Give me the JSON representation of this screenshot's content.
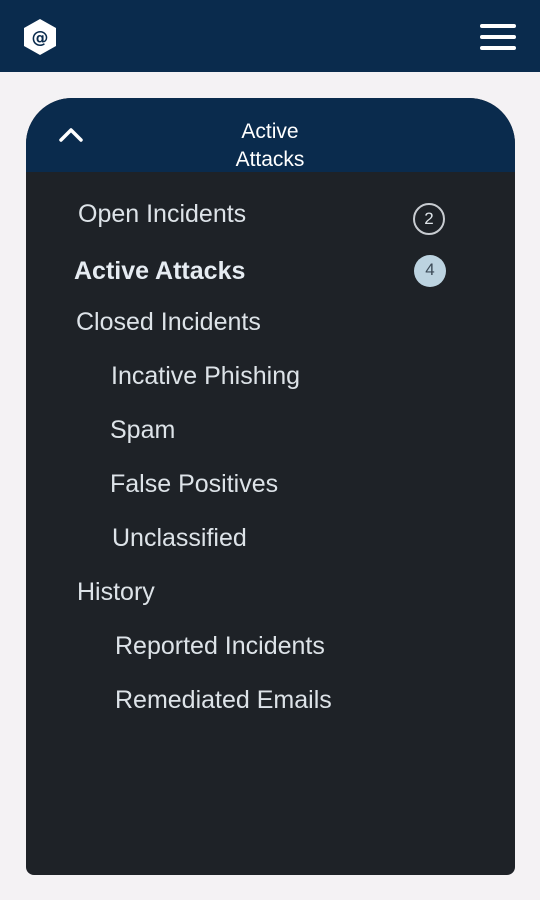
{
  "topbar": {
    "logo_icon": "at-sign-hexagon-icon",
    "menu_icon": "hamburger-menu-icon",
    "background": "#0a2b4d"
  },
  "panel": {
    "title": "Active\nAttacks",
    "collapse_icon": "chevron-up-icon",
    "background": "#1e2227",
    "items": [
      {
        "label": "Open Incidents",
        "count": "2"
      },
      {
        "label": "Active Attacks",
        "count": "4",
        "active": true
      },
      {
        "label": "Closed Incidents"
      },
      {
        "label": "Incative Phishing"
      },
      {
        "label": "Spam"
      },
      {
        "label": "False Positives"
      },
      {
        "label": "Unclassified"
      },
      {
        "label": "History"
      },
      {
        "label": "Reported Incidents"
      },
      {
        "label": "Remediated Emails"
      }
    ]
  }
}
